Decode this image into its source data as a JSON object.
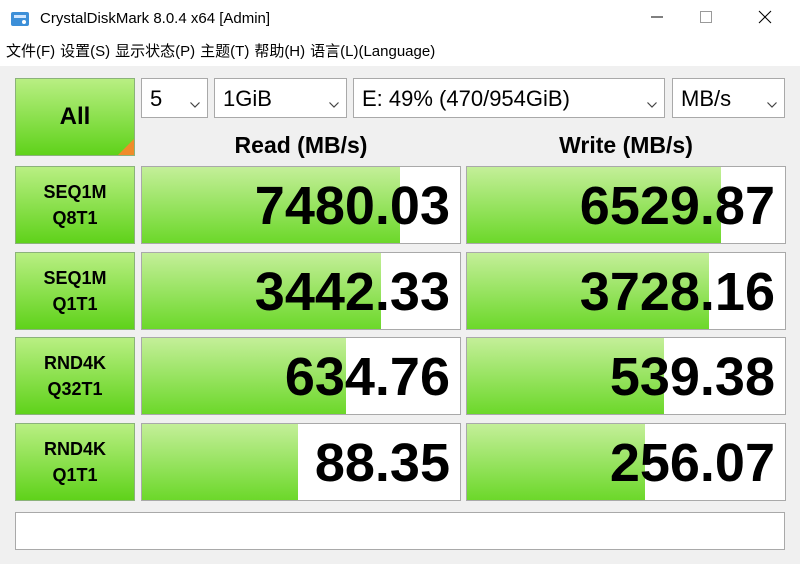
{
  "window": {
    "title": "CrystalDiskMark 8.0.4 x64 [Admin]"
  },
  "menu": [
    "文件(F)",
    "设置(S)",
    "显示状态(P)",
    "主题(T)",
    "帮助(H)",
    "语言(L)(Language)"
  ],
  "all_button": "All",
  "selectors": {
    "count": "5",
    "size": "1GiB",
    "drive": "E: 49% (470/954GiB)",
    "unit": "MB/s"
  },
  "headers": {
    "read": "Read (MB/s)",
    "write": "Write (MB/s)"
  },
  "tests": [
    {
      "line1": "SEQ1M",
      "line2": "Q8T1",
      "read": "7480.03",
      "write": "6529.87",
      "read_fill": 0.81,
      "write_fill": 0.8
    },
    {
      "line1": "SEQ1M",
      "line2": "Q1T1",
      "read": "3442.33",
      "write": "3728.16",
      "read_fill": 0.75,
      "write_fill": 0.76
    },
    {
      "line1": "RND4K",
      "line2": "Q32T1",
      "read": "634.76",
      "write": "539.38",
      "read_fill": 0.64,
      "write_fill": 0.62
    },
    {
      "line1": "RND4K",
      "line2": "Q1T1",
      "read": "88.35",
      "write": "256.07",
      "read_fill": 0.49,
      "write_fill": 0.56
    }
  ],
  "comment": "",
  "colors": {
    "accent_green": "#6cd82a",
    "corner_orange": "#f08b2a"
  },
  "icons": {
    "app": "crystaldiskmark-icon",
    "min": "minimize-icon",
    "max": "maximize-icon",
    "close": "close-icon",
    "dropdown": "chevron-down-icon"
  }
}
